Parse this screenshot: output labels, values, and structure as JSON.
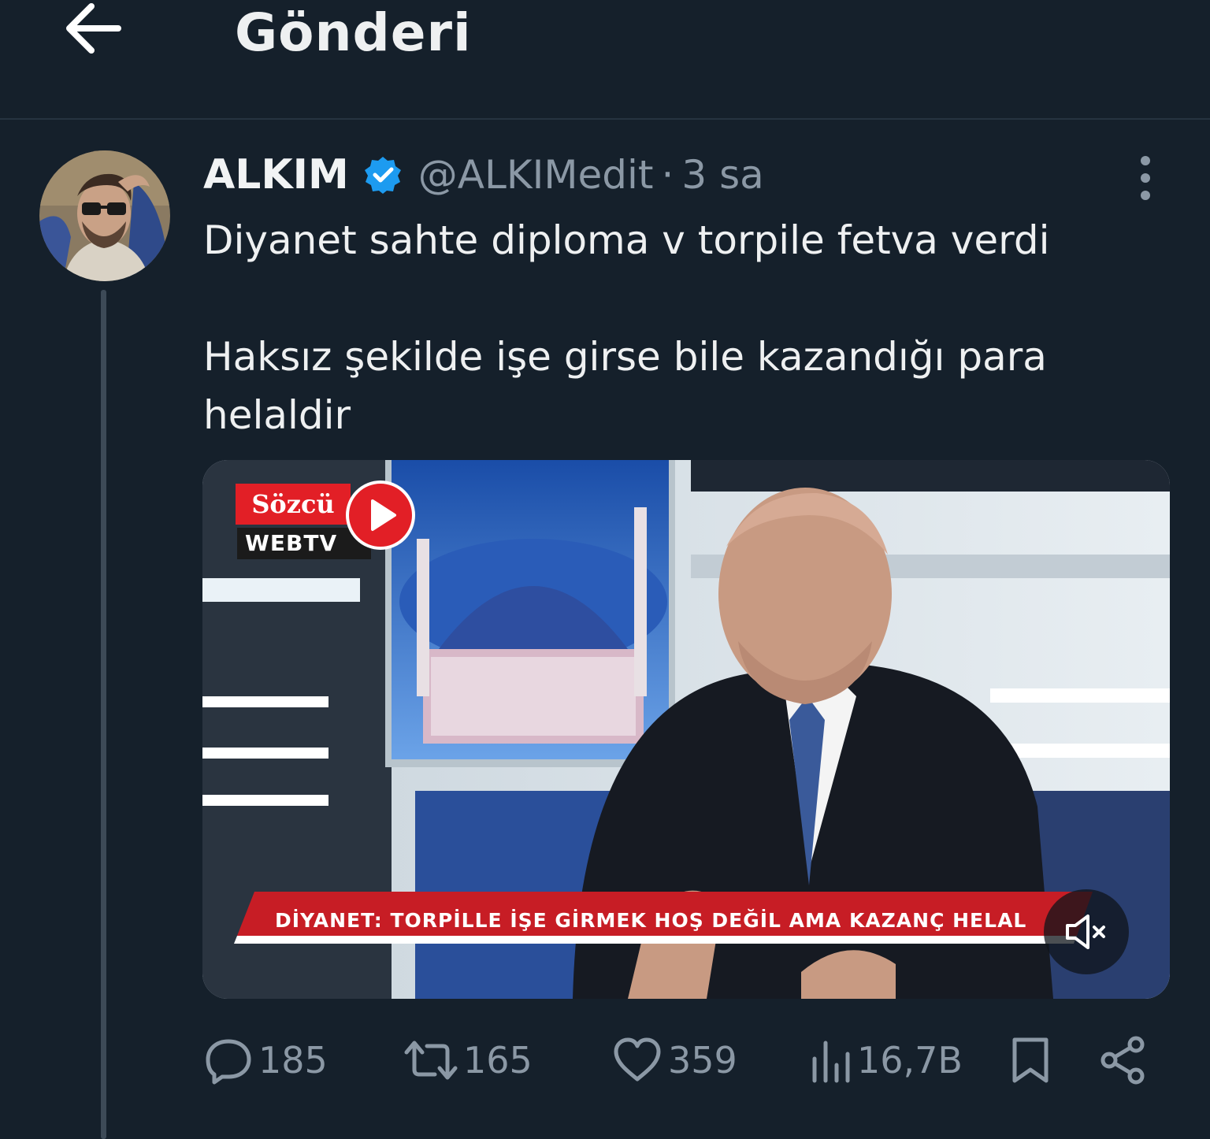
{
  "header": {
    "back_icon": "arrow-left-icon",
    "title": "Gönderi"
  },
  "tweet": {
    "author": {
      "display_name": "ALKIM",
      "handle": "@ALKIMedit",
      "verified": true,
      "verified_color": "#1d9bf0",
      "avatar_icon": "avatar-photo"
    },
    "separator": "·",
    "time": "3 sa",
    "more_icon": "more-vertical-icon",
    "text_lines": [
      "Diyanet sahte diploma v torpile fetva verdi",
      "Haksız şekilde işe girse bile kazandığı para helaldir"
    ],
    "media": {
      "type": "video",
      "logo_top": "Sözcü",
      "logo_bottom": "WEBTV",
      "caption": "DİYANET: TORPİLLE İŞE GİRMEK HOŞ DEĞİL AMA KAZANÇ HELAL",
      "mute_icon": "volume-muted-icon",
      "accent_color": "#e21f26"
    },
    "actions": {
      "reply": {
        "icon": "reply-icon",
        "count": "185"
      },
      "retweet": {
        "icon": "retweet-icon",
        "count": "165"
      },
      "like": {
        "icon": "heart-icon",
        "count": "359"
      },
      "views": {
        "icon": "views-chart-icon",
        "count": "16,7B"
      },
      "bookmark": {
        "icon": "bookmark-icon"
      },
      "share": {
        "icon": "share-icon"
      }
    }
  },
  "colors": {
    "background": "#15202b",
    "text": "#e7e9ea",
    "secondary_text": "#8b98a5",
    "divider": "#263340"
  }
}
